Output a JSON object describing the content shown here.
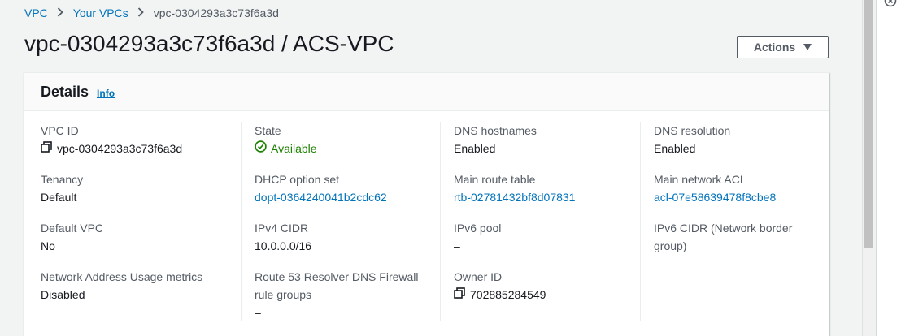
{
  "breadcrumb": {
    "items": [
      "VPC",
      "Your VPCs",
      "vpc-0304293a3c73f6a3d"
    ]
  },
  "title": "vpc-0304293a3c73f6a3d / ACS-VPC",
  "actions_label": "Actions",
  "details": {
    "heading": "Details",
    "info_link": "Info",
    "fields": {
      "vpc_id": {
        "label": "VPC ID",
        "value": "vpc-0304293a3c73f6a3d"
      },
      "tenancy": {
        "label": "Tenancy",
        "value": "Default"
      },
      "default_vpc": {
        "label": "Default VPC",
        "value": "No"
      },
      "nau_metrics": {
        "label": "Network Address Usage metrics",
        "value": "Disabled"
      },
      "state": {
        "label": "State",
        "value": "Available"
      },
      "dhcp": {
        "label": "DHCP option set",
        "value": "dopt-0364240041b2cdc62"
      },
      "ipv4_cidr": {
        "label": "IPv4 CIDR",
        "value": "10.0.0.0/16"
      },
      "r53_firewall": {
        "label_line1": "Route 53 Resolver DNS Firewall",
        "label_line2": "rule groups",
        "value": "–"
      },
      "dns_hostnames": {
        "label": "DNS hostnames",
        "value": "Enabled"
      },
      "main_route_table": {
        "label": "Main route table",
        "value": "rtb-02781432bf8d07831"
      },
      "ipv6_pool": {
        "label": "IPv6 pool",
        "value": "–"
      },
      "owner_id": {
        "label": "Owner ID",
        "value": "702885284549"
      },
      "dns_resolution": {
        "label": "DNS resolution",
        "value": "Enabled"
      },
      "main_network_acl": {
        "label": "Main network ACL",
        "value": "acl-07e58639478f8cbe8"
      },
      "ipv6_cidr": {
        "label_line1": "IPv6 CIDR (Network border",
        "label_line2": "group)",
        "value": "–"
      }
    }
  },
  "colors": {
    "link": "#0073bb",
    "success": "#1d8102",
    "text": "#16191f",
    "muted": "#545b64"
  }
}
